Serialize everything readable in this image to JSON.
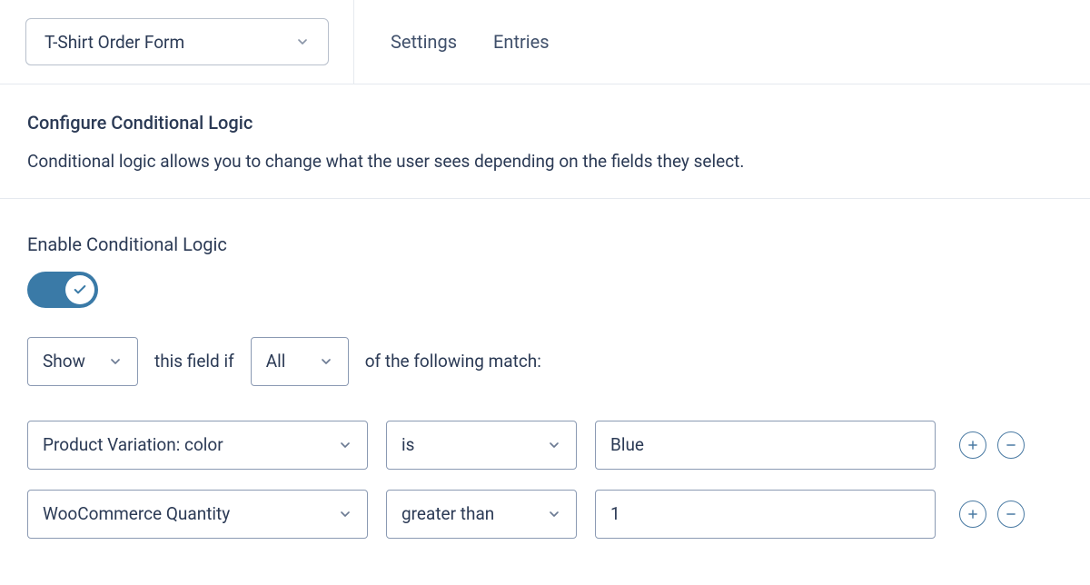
{
  "header": {
    "form_selector": "T-Shirt Order Form",
    "tab_settings": "Settings",
    "tab_entries": "Entries"
  },
  "intro": {
    "title": "Configure Conditional Logic",
    "description": "Conditional logic allows you to change what the user sees depending on the fields they select."
  },
  "enable": {
    "label": "Enable Conditional Logic",
    "on": true
  },
  "sentence": {
    "show_hide": "Show",
    "mid_text": "this field if",
    "all_any": "All",
    "tail_text": "of the following match:"
  },
  "conditions": [
    {
      "field": "Product Variation: color",
      "operator": "is",
      "value": "Blue"
    },
    {
      "field": "WooCommerce Quantity",
      "operator": "greater than",
      "value": "1"
    }
  ]
}
